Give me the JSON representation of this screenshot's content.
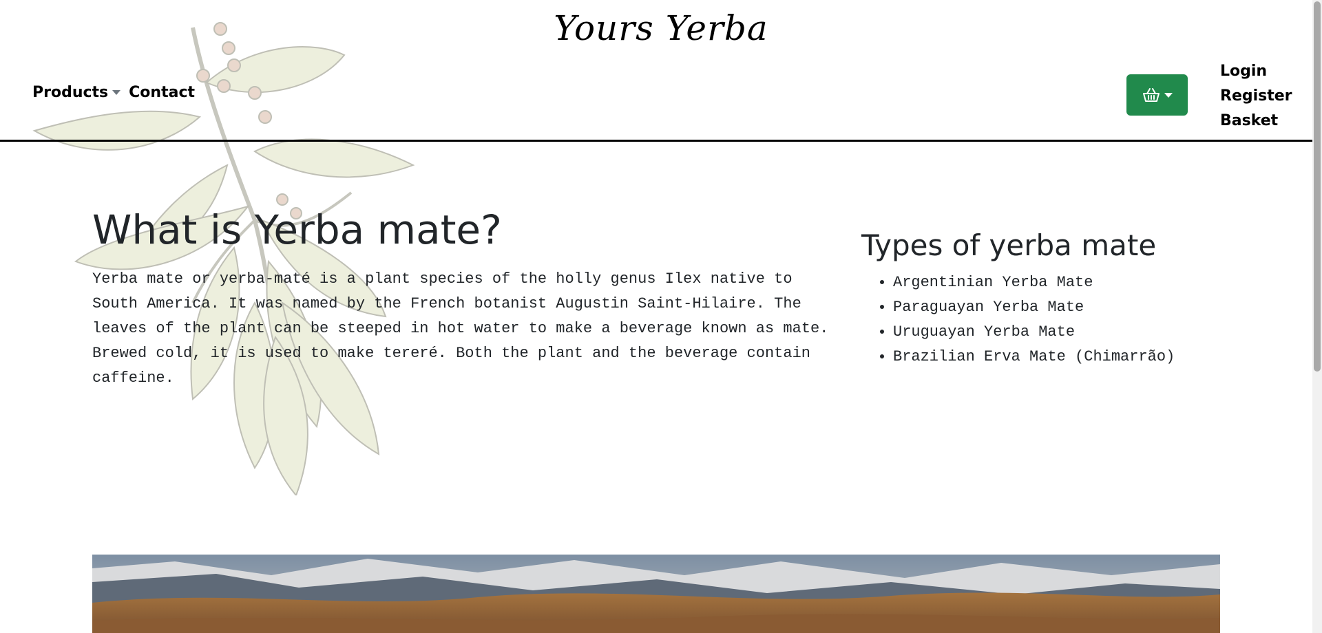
{
  "header": {
    "site_title": "Yours Yerba",
    "nav": {
      "products_label": "Products",
      "contact_label": "Contact"
    },
    "basket_button_icon": "basket-icon",
    "account": {
      "login_label": "Login",
      "register_label": "Register",
      "basket_label": "Basket"
    }
  },
  "main": {
    "title": "What is Yerba mate?",
    "intro": "Yerba mate or yerba-maté is a plant species of the holly genus Ilex native to South America. It was named by the French botanist Augustin Saint-Hilaire. The leaves of the plant can be steeped in hot water to make a beverage known as mate. Brewed cold, it is used to make tereré. Both the plant and the beverage contain caffeine."
  },
  "types": {
    "title": "Types of yerba mate",
    "items": [
      "Argentinian Yerba Mate",
      "Paraguayan Yerba Mate",
      "Uruguayan Yerba Mate",
      "Brazilian Erva Mate (Chimarrão)"
    ]
  },
  "colors": {
    "accent_green": "#218a4c",
    "text": "#212529",
    "rule": "#000000"
  }
}
